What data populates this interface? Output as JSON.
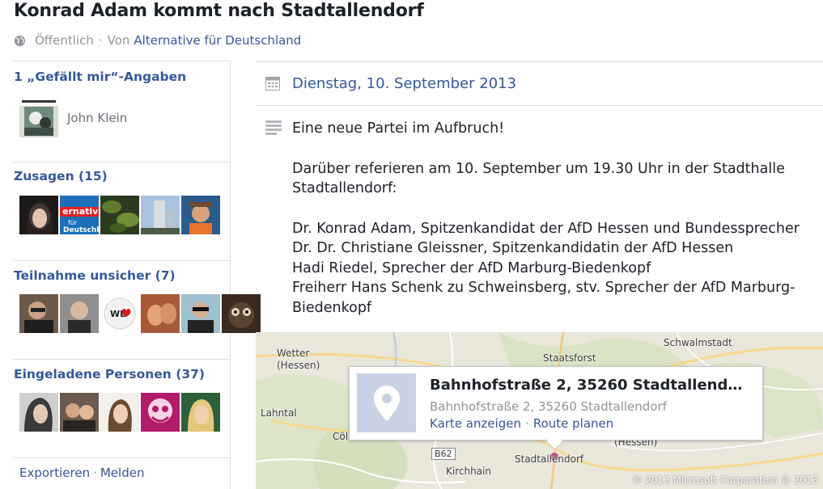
{
  "event": {
    "title": "Konrad Adam kommt nach Stadtallendorf",
    "privacy": "Öffentlich",
    "separator": "·",
    "by_prefix": "Von",
    "host": "Alternative für Deutschland"
  },
  "sidebar": {
    "likes": {
      "heading": "1 „Gefällt mir“-Angaben",
      "person": "John Klein"
    },
    "attending": {
      "heading": "Zusagen (15)"
    },
    "maybe": {
      "heading": "Teilnahme unsicher (7)"
    },
    "invited": {
      "heading": "Eingeladene Personen (37)"
    },
    "footer": {
      "export": "Exportieren",
      "dot": "·",
      "report": "Melden"
    }
  },
  "details": {
    "date": "Dienstag, 10. September 2013",
    "description_1": "Eine neue Partei im Aufbruch!",
    "description_2": "Darüber referieren am 10. September um 19.30 Uhr in der Stadthalle Stadtallendorf:",
    "description_3": "Dr. Konrad Adam, Spitzenkandidat der AfD Hessen und Bundessprecher\nDr. Dr. Christiane Gleissner, Spitzenkandidatin der AfD Hessen\nHadi Riedel, Sprecher der AfD Marburg-Biedenkopf\nFreiherr Hans Schenk zu Schweinsberg, stv. Sprecher der AfD Marburg-Biedenkopf"
  },
  "map": {
    "labels": {
      "wetter": "Wetter\n(Hessen)",
      "schwalmstadt": "Schwalmstadt",
      "staatsforst": "Staatsforst",
      "lahntal": "Lahntal",
      "coelbe": "Cöl",
      "hessen": "(Hessen)",
      "b62": "B62",
      "kirchhain": "Kirchhain",
      "stadtallendorf": "Stadtallendorf"
    },
    "copyright": "© 2013 Microsoft Corporation © 2013",
    "card": {
      "title": "Bahnhofstraße 2, 35260 Stadtallend…",
      "address": "Bahnhofstraße 2, 35260 Stadtallendorf",
      "show_map": "Karte anzeigen",
      "dot": "·",
      "route": "Route planen"
    }
  },
  "colors": {
    "link": "#365899",
    "muted": "#90949c",
    "border": "#dddfe2",
    "map_bg": "#eae7dc",
    "map_marker": "#b5507a"
  },
  "icons": [
    "globe-icon",
    "calendar-icon",
    "description-lines-icon",
    "map-pin-icon",
    "map-marker-icon"
  ]
}
